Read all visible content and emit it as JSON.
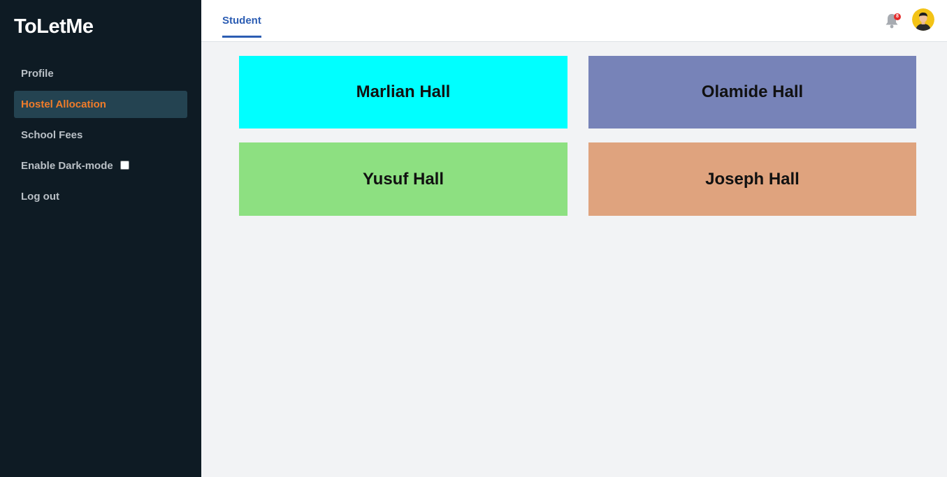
{
  "brand": "ToLetMe",
  "sidebar": {
    "items": [
      {
        "label": "Profile"
      },
      {
        "label": "Hostel Allocation",
        "active": true
      },
      {
        "label": "School Fees"
      },
      {
        "label": "Enable Dark-mode",
        "checked": false
      },
      {
        "label": "Log out"
      }
    ]
  },
  "header": {
    "tab": "Student",
    "notification_count": "8",
    "bell_icon": "bell-icon",
    "avatar": "user-avatar"
  },
  "halls": [
    {
      "name": "Marlian Hall",
      "color": "#00ffff"
    },
    {
      "name": "Olamide Hall",
      "color": "#7783b8"
    },
    {
      "name": "Yusuf Hall",
      "color": "#8de081"
    },
    {
      "name": "Joseph Hall",
      "color": "#dfa37e"
    }
  ],
  "colors": {
    "sidebar_bg": "#0e1b24",
    "active_bg": "#244351",
    "active_text": "#f07c2a",
    "tab_accent": "#2c5db3"
  }
}
